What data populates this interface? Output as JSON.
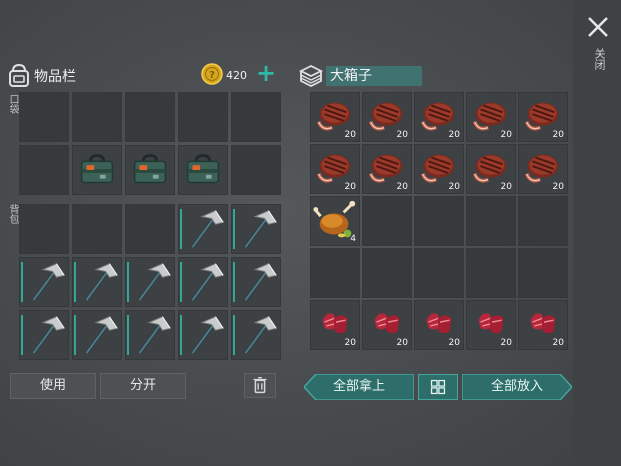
{
  "close": {
    "label": "关闭"
  },
  "inventory": {
    "title": "物品栏",
    "coins": "420",
    "pocket_label": "口袋",
    "backpack_label": "背包"
  },
  "chest": {
    "title": "大箱子",
    "slots": [
      {
        "item": "steak-icon",
        "count": "20"
      },
      {
        "item": "steak-icon",
        "count": "20"
      },
      {
        "item": "steak-icon",
        "count": "20"
      },
      {
        "item": "steak-icon",
        "count": "20"
      },
      {
        "item": "steak-icon",
        "count": "20"
      },
      {
        "item": "steak-icon",
        "count": "20"
      },
      {
        "item": "steak-icon",
        "count": "20"
      },
      {
        "item": "steak-icon",
        "count": "20"
      },
      {
        "item": "steak-icon",
        "count": "20"
      },
      {
        "item": "steak-icon",
        "count": "20"
      },
      {
        "item": "roast-chicken-icon",
        "count": "4"
      },
      {
        "item": "",
        "count": ""
      },
      {
        "item": "",
        "count": ""
      },
      {
        "item": "",
        "count": ""
      },
      {
        "item": "",
        "count": ""
      },
      {
        "item": "",
        "count": ""
      },
      {
        "item": "",
        "count": ""
      },
      {
        "item": "",
        "count": ""
      },
      {
        "item": "",
        "count": ""
      },
      {
        "item": "",
        "count": ""
      },
      {
        "item": "raw-meat-icon",
        "count": "20"
      },
      {
        "item": "raw-meat-icon",
        "count": "20"
      },
      {
        "item": "raw-meat-icon",
        "count": "20"
      },
      {
        "item": "raw-meat-icon",
        "count": "20"
      },
      {
        "item": "raw-meat-icon",
        "count": "20"
      }
    ]
  },
  "buttons": {
    "use": "使用",
    "split": "分开",
    "take_all": "全部拿上",
    "put_all": "全部放入"
  },
  "colors": {
    "accent": "#2fb8a8",
    "slot": "#3d4143"
  }
}
